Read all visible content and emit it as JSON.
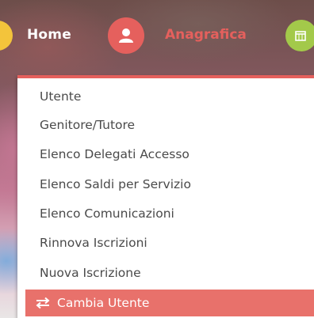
{
  "nav": {
    "home_label": "Home",
    "anagrafica_label": "Anagrafica",
    "colors": {
      "home_icon": "#f3c43b",
      "anagrafica_icon": "#e5605d",
      "calendar_icon": "#a3c94a"
    },
    "icons": {
      "home": "home-icon",
      "anagrafica": "user-icon",
      "calendar": "calendar-icon"
    }
  },
  "menu": {
    "accent": "#e5605d",
    "items": [
      {
        "label": "Utente"
      },
      {
        "label": "Genitore/Tutore"
      },
      {
        "label": "Elenco Delegati Accesso"
      },
      {
        "label": "Elenco Saldi per Servizio"
      },
      {
        "label": "Elenco Comunicazioni"
      },
      {
        "label": "Rinnova Iscrizioni"
      },
      {
        "label": "Nuova Iscrizione"
      }
    ],
    "active": {
      "label": "Cambia Utente",
      "icon": "swap-arrows-icon",
      "background": "#e8716b"
    }
  }
}
